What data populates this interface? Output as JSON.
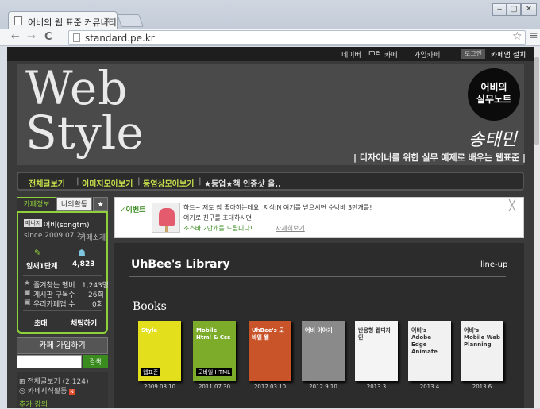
{
  "browser": {
    "tab_title": "어비의 웹 표준 커뮤니티",
    "tab_close": "×",
    "url": "standard.pe.kr",
    "back": "←",
    "forward": "→",
    "reload": "C",
    "star": "☆",
    "menu": "≡",
    "win_min": "‒",
    "win_max": "▢",
    "win_close": "✕"
  },
  "gnb": {
    "naver": "네이버",
    "me": "me",
    "cafe": "카페",
    "joined": "가입카페",
    "login": "로그인",
    "install": "카페앱 설치"
  },
  "hero": {
    "web": "Web",
    "style": "Style",
    "badge": "어비의\n실무노트",
    "signature": "송태민",
    "tagline": "| 디자이너를 위한 실무 예제로 배우는 웹표준 |"
  },
  "menu": [
    "전체글보기",
    "이미지모아보기",
    "동영상모아보기",
    "★등업★책 인증샷 올.."
  ],
  "sidebar": {
    "tab_info": "카페정보",
    "tab_activity": "나의활동",
    "tab_star": "★",
    "manager_badge": "매니저",
    "name": "어비(songtm)",
    "since": "since 2009.07.21",
    "intro": "카페소개",
    "level": "잎새1단계",
    "members": "4,823",
    "fav_label": "즐겨찾는 멤버",
    "fav_value": "1,243명",
    "sub_label": "게시판 구독수",
    "sub_value": "26회",
    "app_label": "우리카페앱 수",
    "app_value": "0회",
    "invite": "초대",
    "chat": "채팅하기",
    "join": "카페 가입하기",
    "search": "검색",
    "all_posts": "전체글보기 (2,124)",
    "cafe_knowledge": "카페지식활동",
    "extra": "추가 강의"
  },
  "notice": {
    "label": "✓이벤트",
    "line1": "하드~ 저도 참 좋아하는데요, 지식iN 여기를 받으시면 수박바 3만개를!",
    "line2": "여기로 친구를 초대하시면",
    "line3": "조스바 2만개를 드립니다!",
    "more": "자세히보기",
    "close": "╳"
  },
  "library": {
    "title": "UhBee's Library",
    "lineup": "line-up",
    "books_heading": "Books",
    "books": [
      {
        "cover": "Style",
        "sub": "웹표준",
        "date": "2009.08.10",
        "color": "#e3df1c"
      },
      {
        "cover": "Mobile Html & Css",
        "sub": "모바일 HTML",
        "date": "2011.07.30",
        "color": "#7dab2a"
      },
      {
        "cover": "UhBee's 모바일 웹",
        "sub": "",
        "date": "2012.03.10",
        "color": "#c9542a"
      },
      {
        "cover": "어비 이야기",
        "sub": "",
        "date": "2012.9.10",
        "color": "#8a8a8a"
      },
      {
        "cover": "반응형 웹디자인",
        "sub": "",
        "date": "2013.3",
        "color": "#f4f4f4"
      },
      {
        "cover": "어비's Adobe Edge Animate",
        "sub": "",
        "date": "2013.4",
        "color": "#f1f1f1"
      },
      {
        "cover": "어비's Mobile Web Planning",
        "sub": "",
        "date": "2013.6",
        "color": "#f1f1f1"
      }
    ]
  }
}
